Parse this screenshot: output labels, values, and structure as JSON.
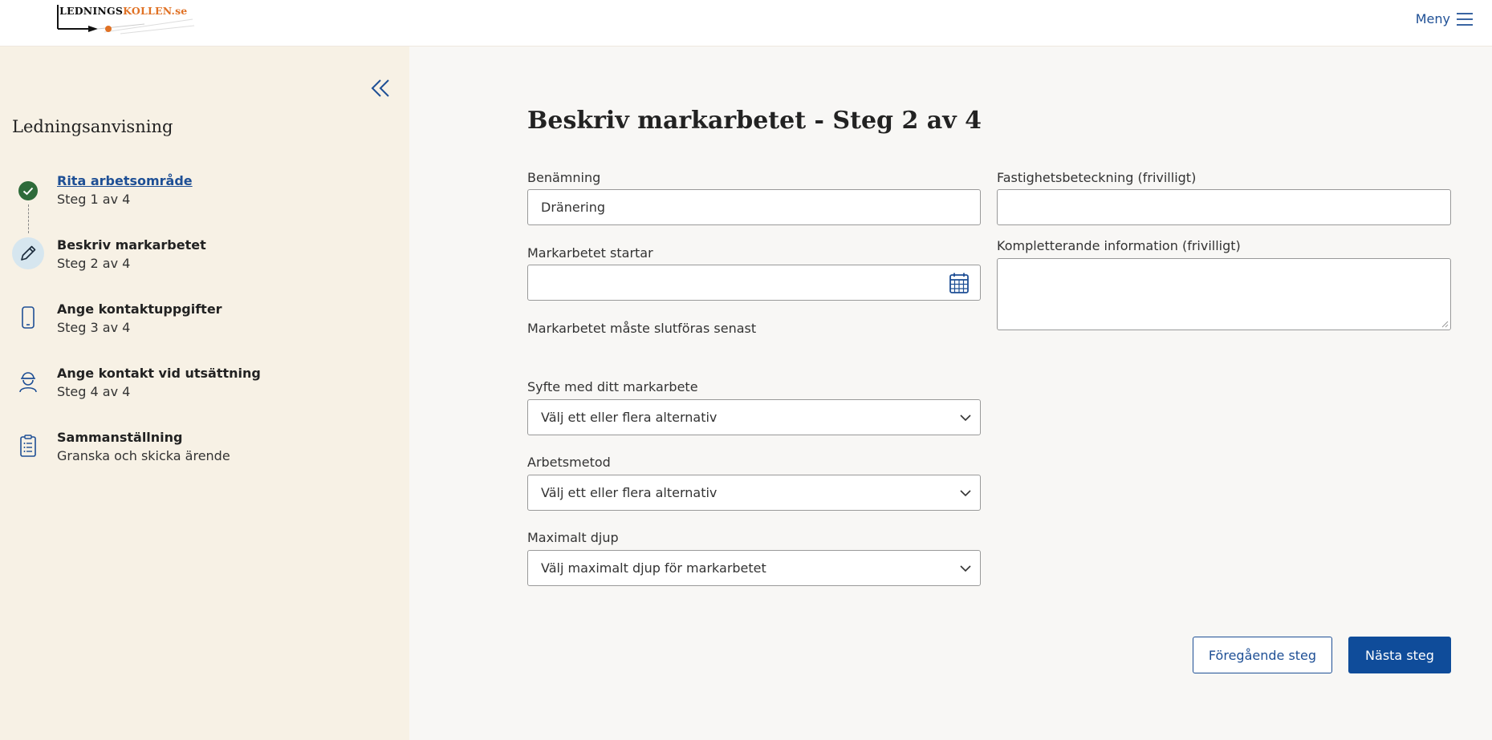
{
  "header": {
    "logo_part1": "LEDNINGS",
    "logo_part2": "KOLLEN.se",
    "menu_label": "Meny",
    "menu_icon": "hamburger-icon"
  },
  "sidebar": {
    "title": "Ledningsanvisning",
    "collapse_icon": "double-chevron-left-icon",
    "steps": [
      {
        "label": "Rita arbetsområde",
        "sub": "Steg 1 av 4",
        "icon": "check-circle-icon",
        "status": "done"
      },
      {
        "label": "Beskriv markarbetet",
        "sub": "Steg 2 av 4",
        "icon": "pencil-icon",
        "status": "active"
      },
      {
        "label": "Ange kontaktuppgifter",
        "sub": "Steg 3 av 4",
        "icon": "mobile-phone-icon",
        "status": "todo"
      },
      {
        "label": "Ange kontakt vid utsättning",
        "sub": "Steg 4 av 4",
        "icon": "worker-icon",
        "status": "todo"
      },
      {
        "label": "Sammanställning",
        "sub": "Granska och skicka ärende",
        "icon": "clipboard-icon",
        "status": "todo"
      }
    ]
  },
  "main": {
    "title": "Beskriv markarbetet - Steg 2 av 4",
    "fields": {
      "name_label": "Benämning",
      "name_value": "Dränering",
      "start_label": "Markarbetet startar",
      "start_value": "",
      "end_text": "Markarbetet måste slutföras senast",
      "purpose_label": "Syfte med ditt markarbete",
      "purpose_value": "Välj ett eller flera alternativ",
      "method_label": "Arbetsmetod",
      "method_value": "Välj ett eller flera alternativ",
      "depth_label": "Maximalt djup",
      "depth_value": "Välj maximalt djup för markarbetet",
      "property_label": "Fastighetsbeteckning (frivilligt)",
      "property_value": "",
      "info_label": "Kompletterande information (frivilligt)",
      "info_value": ""
    },
    "buttons": {
      "prev": "Föregående steg",
      "next": "Nästa steg"
    }
  },
  "colors": {
    "accent": "#1e4f95",
    "primary_button": "#0f4c9a",
    "sidebar_bg": "#f7f1e5",
    "done_green": "#2e6b3a",
    "logo_orange": "#e07124"
  }
}
